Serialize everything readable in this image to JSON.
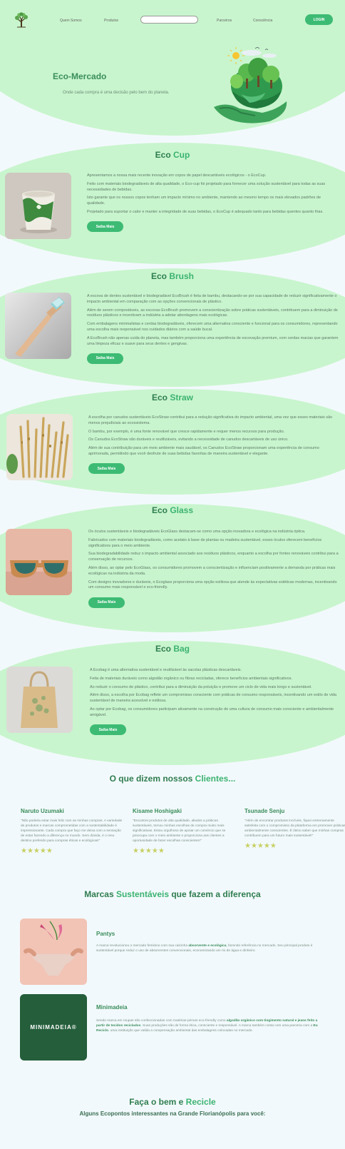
{
  "nav": {
    "links": [
      "Quem Somos",
      "Produtos",
      "Parceiros",
      "Consciência"
    ],
    "login": "LOGIN"
  },
  "hero": {
    "title": "Eco-Mercado",
    "subtitle": "Onde cada compra é uma decisão pelo bem do planeta."
  },
  "products": [
    {
      "title_a": "Eco ",
      "title_b": "Cup",
      "paragraphs": [
        "Apresentamos a nossa mais recente inovação em copos de papel descartáveis ecológicos - o EcoCup.",
        "Feito com materiais biodegradáveis de alta qualidade, o Eco-cup foi projetado para fornecer uma solução sustentável para todas as suas necessidades de bebidas.",
        "Isto garante que os nossos copos tenham um impacto mínimo no ambiente, mantendo ao mesmo tempo os mais elevados padrões de qualidade.",
        "Projetado para suportar o calor e manter a integridade de suas bebidas, o EcoCup é adequado tanto para bebidas quentes quanto frias."
      ],
      "button": "Saiba Mais"
    },
    {
      "title_a": "Eco ",
      "title_b": "Brush",
      "paragraphs": [
        "A escova de dentes sustentável e biodegradável EcoBrush é feita de bambu, destacando-se por sua capacidade de reduzir significativamente o impacto ambiental em comparação com as opções convencionais de plástico.",
        "Além de serem compostáveis, as escovas EcoBrush promovem a conscientização sobre práticas sustentáveis, contribuem para a diminuição de resíduos plásticos e incentivam a indústria a adotar abordagens mais ecológicas.",
        "Com embalagens minimalistas e cerdas biodegradáveis, oferecem uma alternativa consciente e funcional para os consumidores, representando uma escolha mais responsável nos cuidados diários com a saúde bucal.",
        "A EcoBrush não apenas cuida do planeta, mas também proporciona uma experiência de escovação premium, com cerdas macias que garantem uma limpeza eficaz e suave para seus dentes e gengivas."
      ],
      "button": "Saiba Mais"
    },
    {
      "title_a": "Eco ",
      "title_b": "Straw",
      "paragraphs": [
        "A escolha por canudos sustentáveis EcoStraw contribui para a redução significativa do impacto ambiental, uma vez que esses materiais são menos prejudiciais ao ecossistema.",
        "O bambu, por exemplo, é uma fonte renovável que cresce rapidamente e requer menos recursos para produção.",
        "Os Canudos EcoStraw são duráveis e reutilizáveis, evitando a necessidade de canudos descartáveis de uso único.",
        "Além de sua contribuição para um meio ambiente mais saudável, os Canudos EcoStraw proporcionam uma experiência de consumo aprimorada, permitindo que você desfrute de suas bebidas favoritas de maneira sustentável e elegante."
      ],
      "button": "Saiba Mais"
    },
    {
      "title_a": "Eco ",
      "title_b": "Glass",
      "paragraphs": [
        "Os óculos sustentáveis e biodegradáveis EcoGlass destacam-se como uma opção inovadora e ecológica na indústria óptica.",
        "Fabricados com materiais biodegradáveis, como acetato à base de plantas ou madeira sustentável, esses óculos oferecem benefícios significativos para o meio ambiente.",
        "Sua biodegradabilidade reduz o impacto ambiental associado aos resíduos plásticos, enquanto a escolha por fontes renováveis contribui para a conservação de recursos.",
        "Além disso, ao optar pelo EcoGlass, os consumidores promovem a conscientização e influenciam positivamente a demanda por práticas mais ecológicas na indústria da moda.",
        "Com designs inovadores e duráveis, o Ecoglass proporciona uma opção estilosa que atende às expectativas estéticas modernas, incentivando um consumo mais responsável e eco-friendly."
      ],
      "button": "Saiba Mais"
    },
    {
      "title_a": "Eco ",
      "title_b": "Bag",
      "paragraphs": [
        "A Ecobag é uma alternativa sustentável e reutilizável às sacolas plásticas descartáveis.",
        "Feita de materiais duráveis como algodão orgânico ou fibras recicladas, oferece benefícios ambientais significativos.",
        "Ao reduzir o consumo de plástico, contribui para a diminuição da poluição e promove um ciclo de vida mais longo e sustentável.",
        "Além disso, a escolha por Ecobag reflete um compromisso consciente com práticas de consumo responsáveis, incentivando um estilo de vida sustentável de maneira acessível e estilosa.",
        "Ao optar por Ecobag, os consumidores participam ativamente na construção de uma cultura de consumo mais consciente e ambientalmente amigável."
      ],
      "button": "Saiba Mais"
    }
  ],
  "testimonials": {
    "title_a": "O que dizem nossos ",
    "title_b": "Clientes...",
    "items": [
      {
        "name": "Naruto Uzumaki",
        "text": "\"Não poderia estar mais feliz com as minhas compras. A variedade de produtos e marcas comprometidas com a sustentabilidade é impressionante. Cada compra que faço me deixa com a sensação de estar fazendo a diferença no mundo. Sem dúvida, é o meu destino preferido para compras éticas e ecológicas!\"",
        "stars": 5
      },
      {
        "name": "Kisame Hoshigaki",
        "text": "\"Encontrei produtos de alta qualidade, aliados a práticas sustentáveis, tornou minhas escolhas de compra muito mais significativas. Estou orgulhoso de apoiar um comércio que se preocupa com o meio ambiente e proporciona aos clientes a oportunidade de fazer escolhas conscientes!\"",
        "stars": 5
      },
      {
        "name": "Tsunade Senju",
        "text": "\"Além de encontrar produtos incríveis, fiquei extremamente satisfeita com o compromisso da plataforma em promover práticas ambientalmente conscientes. É ótimo saber que minhas compras contribuem para um futuro mais sustentável!\"",
        "stars": 5
      }
    ]
  },
  "brands": {
    "title_a": "Marcas ",
    "title_b": "Sustentáveis",
    "title_c": " que fazem a diferença",
    "items": [
      {
        "name": "Pantys",
        "text_a": "A marca revolucionou o mercado feminino com sua calcinha ",
        "text_b": "absorvente e ecológica",
        "text_c": ", fazendo referência no mercado. Seu principal produto é sustentável porque reduz o uso de absorventes convencionais, economizando um rio de água e dinheiro."
      },
      {
        "name": "Minimadeia",
        "logo_text": "MINIMADEIA®",
        "text_a": "Sendo marca em roupas são confeccionadas com matérias-primas eco-friendly como ",
        "text_b": "algodão orgânico com tingimento natural e jeans feito a partir de tecidos reciclados",
        "text_c": ". Suas produções são de forma ética, consciente e responsável. A marca também conta com uma parceria com a ",
        "text_d": "Eu Reciclo",
        "text_e": ", uma instituição que valida a compensação ambiental das embalagens colocadas no mercado."
      }
    ]
  },
  "footer": {
    "title_a": "Faça o bem e ",
    "title_b": "Recicle",
    "subtitle": "Alguns Ecopontos interessantes na Grande Florianópolis para você:"
  },
  "colors": {
    "accent": "#3dbb74",
    "blob": "#c8f5cd",
    "heading": "#2f7d4f"
  }
}
